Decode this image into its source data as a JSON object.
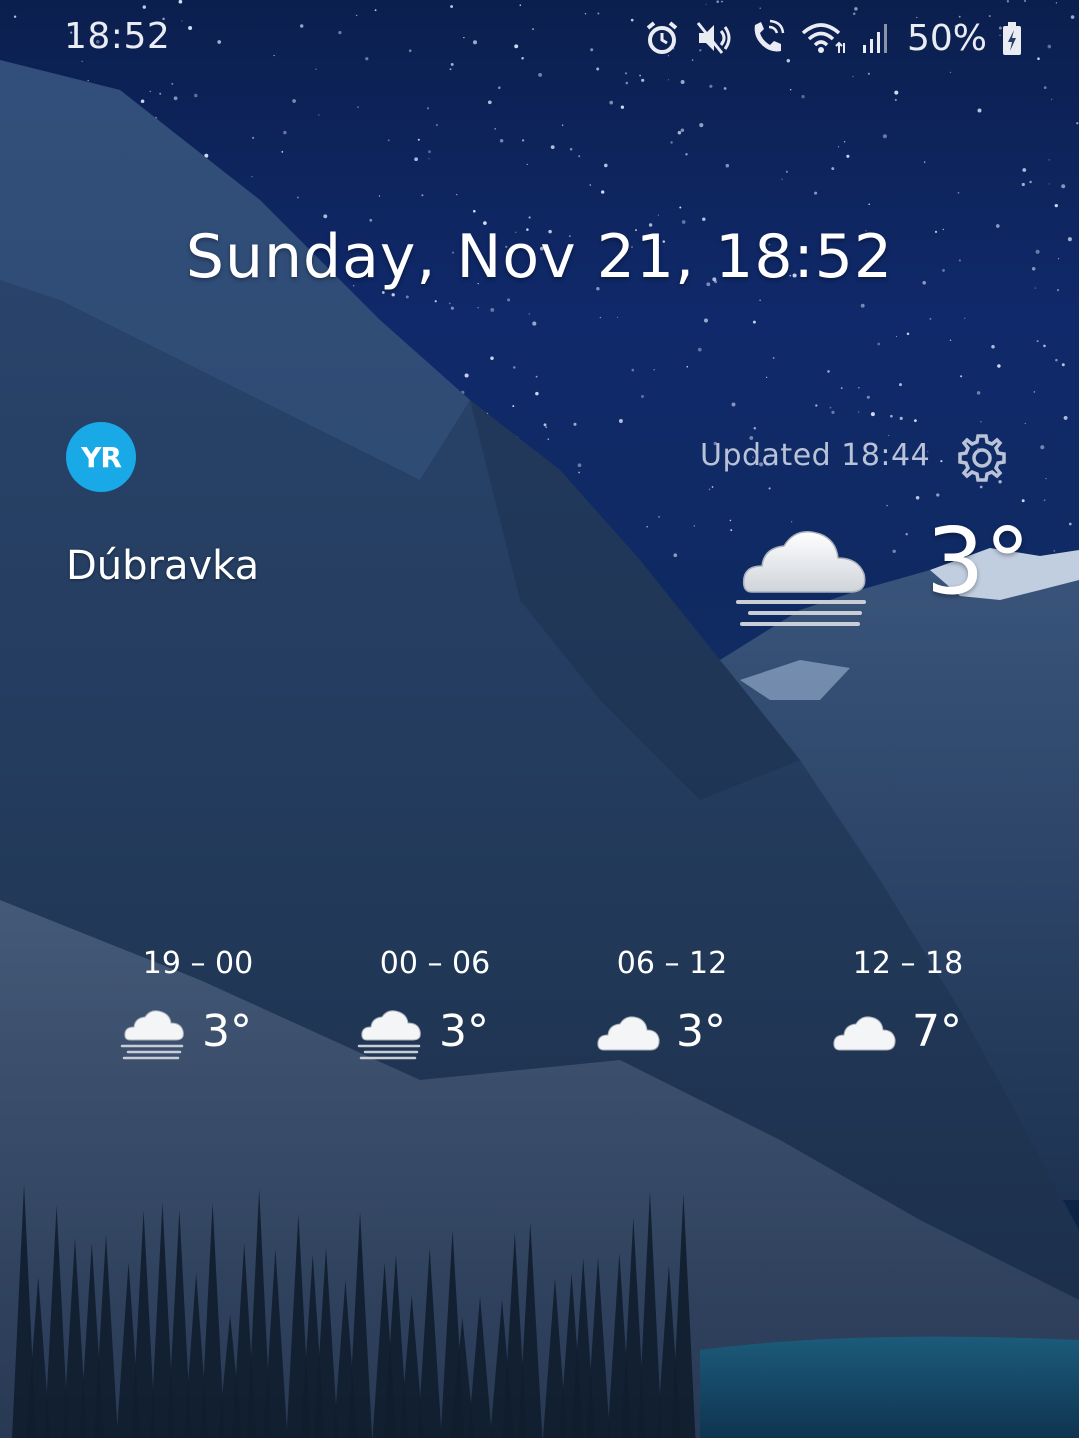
{
  "status_bar": {
    "time": "18:52",
    "battery_percent": "50%",
    "icons": [
      "alarm-icon",
      "mute-icon",
      "wifi-calling-icon",
      "wifi-icon",
      "signal-icon",
      "battery-charging-icon"
    ]
  },
  "clock": {
    "date_time": "Sunday, Nov 21, 18:52"
  },
  "weather": {
    "provider_logo_text": "YR",
    "updated_text": "Updated 18:44",
    "location": "Dúbravka",
    "current": {
      "condition_icon": "cloud-fog-icon",
      "temperature": "3°"
    },
    "forecast": [
      {
        "period": "19 – 00",
        "icon": "cloud-fog-icon",
        "temperature": "3°"
      },
      {
        "period": "00 – 06",
        "icon": "cloud-fog-icon",
        "temperature": "3°"
      },
      {
        "period": "06 – 12",
        "icon": "cloud-icon",
        "temperature": "3°"
      },
      {
        "period": "12 – 18",
        "icon": "cloud-icon",
        "temperature": "7°"
      }
    ]
  },
  "colors": {
    "sky": "#10296a",
    "yr_blue": "#18a9e6",
    "updated_text": "#b9c2d6"
  }
}
